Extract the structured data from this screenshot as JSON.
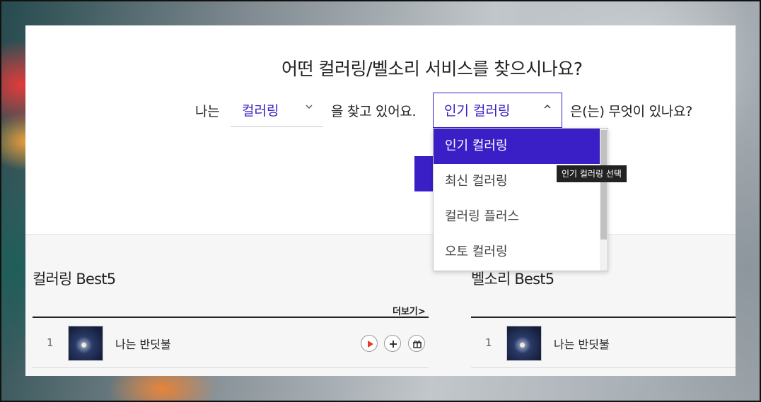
{
  "headline": "어떤 컬러링/벨소리 서비스를 찾으시나요?",
  "sentence": {
    "prefix": "나는",
    "middle": "을 찾고 있어요.",
    "suffix": "은(는) 무엇이 있나요?"
  },
  "select_service": {
    "value": "컬러링",
    "icon": "chevron-down-icon"
  },
  "select_category": {
    "value": "인기 컬러링",
    "icon": "chevron-up-icon",
    "options": [
      "인기 컬러링",
      "최신 컬러링",
      "컬러링 플러스",
      "오토 컬러링"
    ],
    "selected_index": 0
  },
  "tooltip": "인기 컬러링 선택",
  "colors": {
    "accent": "#3a1fc7",
    "play": "#e23a2c"
  },
  "coloring_best": {
    "title": "컬러링 Best5",
    "more": "더보기>",
    "rows": [
      {
        "rank": "1",
        "song": "나는 반딧불"
      }
    ]
  },
  "bell_best": {
    "title": "벨소리 Best5",
    "rows": [
      {
        "rank": "1",
        "song": "나는 반딧불"
      }
    ]
  }
}
